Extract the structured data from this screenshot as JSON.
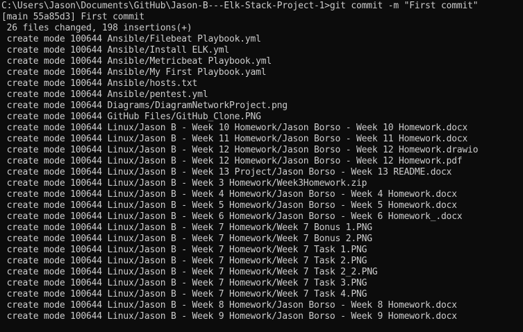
{
  "terminal": {
    "background": "#0c0c0c",
    "foreground": "#cccccc",
    "lines": [
      "C:\\Users\\Jason\\Documents\\GitHub\\Jason-B---Elk-Stack-Project-1>git commit -m \"First commit\"",
      "[main 55a85d3] First commit",
      " 26 files changed, 198 insertions(+)",
      " create mode 100644 Ansible/Filebeat Playbook.yml",
      " create mode 100644 Ansible/Install ELK.yml",
      " create mode 100644 Ansible/Metricbeat Playbook.yml",
      " create mode 100644 Ansible/My First Playbook.yaml",
      " create mode 100644 Ansible/hosts.txt",
      " create mode 100644 Ansible/pentest.yml",
      " create mode 100644 Diagrams/DiagramNetworkProject.png",
      " create mode 100644 GitHub Files/GitHub_Clone.PNG",
      " create mode 100644 Linux/Jason B - Week 10 Homework/Jason Borso - Week 10 Homework.docx",
      " create mode 100644 Linux/Jason B - Week 11 Homework/Jason Borso - Week 11 Homework.docx",
      " create mode 100644 Linux/Jason B - Week 12 Homework/Jason Borso - Week 12 Homework.drawio",
      " create mode 100644 Linux/Jason B - Week 12 Homework/Jason Borso - Week 12 Homework.pdf",
      " create mode 100644 Linux/Jason B - Week 13 Project/Jason Borso - Week 13 README.docx",
      " create mode 100644 Linux/Jason B - Week 3 Homework/Week3Homework.zip",
      " create mode 100644 Linux/Jason B - Week 4 Homework/Jason Borso - Week 4 Homework.docx",
      " create mode 100644 Linux/Jason B - Week 5 Homework/Jason Borso - Week 5 Homework.docx",
      " create mode 100644 Linux/Jason B - Week 6 Homework/Jason Borso - Week 6 Homework_.docx",
      " create mode 100644 Linux/Jason B - Week 7 Homework/Week 7 Bonus 1.PNG",
      " create mode 100644 Linux/Jason B - Week 7 Homework/Week 7 Bonus 2.PNG",
      " create mode 100644 Linux/Jason B - Week 7 Homework/Week 7 Task 1.PNG",
      " create mode 100644 Linux/Jason B - Week 7 Homework/Week 7 Task 2.PNG",
      " create mode 100644 Linux/Jason B - Week 7 Homework/Week 7 Task 2_2.PNG",
      " create mode 100644 Linux/Jason B - Week 7 Homework/Week 7 Task 3.PNG",
      " create mode 100644 Linux/Jason B - Week 7 Homework/Week 7 Task 4.PNG",
      " create mode 100644 Linux/Jason B - Week 8 Homework/Jason Borso - Week 8 Homework.docx",
      " create mode 100644 Linux/Jason B - Week 9 Homework/Jason Borso - Week 9 Homework.docx"
    ]
  }
}
